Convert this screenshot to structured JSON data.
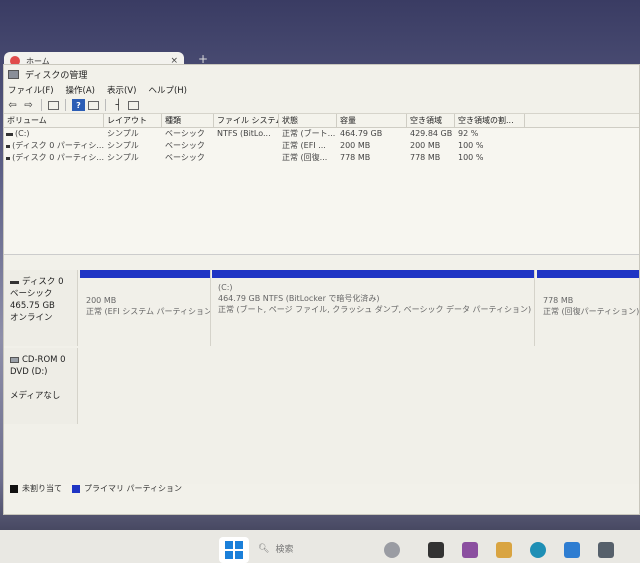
{
  "browser": {
    "tab_label": "ホーム",
    "close_glyph": "×",
    "new_tab_glyph": "+"
  },
  "window": {
    "title": "ディスクの管理"
  },
  "menu": [
    "ファイル(F)",
    "操作(A)",
    "表示(V)",
    "ヘルプ(H)"
  ],
  "volume_table": {
    "columns": [
      "ボリューム",
      "レイアウト",
      "種類",
      "ファイル システム",
      "状態",
      "容量",
      "空き領域",
      "空き領域の割..."
    ],
    "rows": [
      [
        "(C:)",
        "シンプル",
        "ベーシック",
        "NTFS (BitLo...",
        "正常 (ブート...",
        "464.79 GB",
        "429.84 GB",
        "92 %"
      ],
      [
        "(ディスク 0 パーティシ...",
        "シンプル",
        "ベーシック",
        "",
        "正常 (EFI ...",
        "200 MB",
        "200 MB",
        "100 %"
      ],
      [
        "(ディスク 0 パーティシ...",
        "シンプル",
        "ベーシック",
        "",
        "正常 (回復...",
        "778 MB",
        "778 MB",
        "100 %"
      ]
    ]
  },
  "disk0": {
    "name": "ディスク 0",
    "type": "ベーシック",
    "size": "465.75 GB",
    "status": "オンライン",
    "partitions": [
      {
        "title": "",
        "line1": "200 MB",
        "line2": "正常 (EFI システム パーティション)"
      },
      {
        "title": "(C:)",
        "line1": "464.79 GB NTFS (BitLocker で暗号化済み)",
        "line2": "正常 (ブート, ページ ファイル, クラッシュ ダンプ, ベーシック データ パーティション)"
      },
      {
        "title": "",
        "line1": "778 MB",
        "line2": "正常 (回復パーティション)"
      }
    ]
  },
  "cdrom0": {
    "name": "CD-ROM 0",
    "drive": "DVD (D:)",
    "media": "メディアなし"
  },
  "legend": {
    "unallocated": "未割り当て",
    "primary": "プライマリ パーティション"
  },
  "taskbar": {
    "search_label": "検索"
  },
  "colors": {
    "primary_partition": "#1f35c4",
    "unallocated": "#111111",
    "start_blue": "#1a7fd9"
  }
}
